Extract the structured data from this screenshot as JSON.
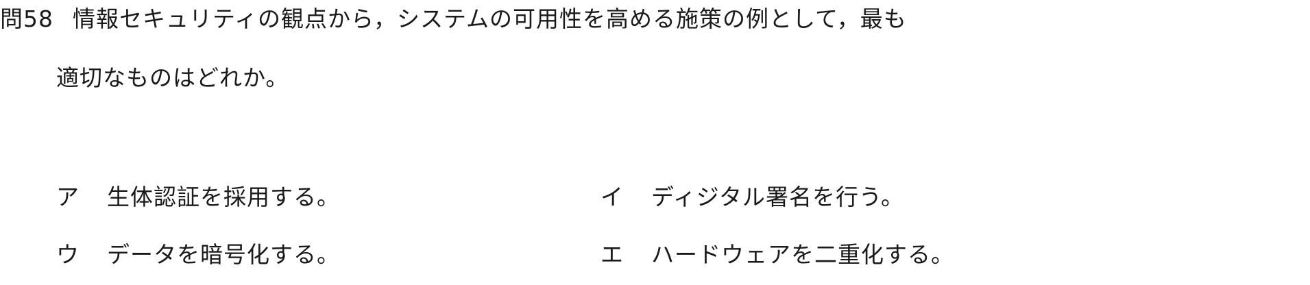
{
  "question": {
    "number": "問58",
    "text_line1": "情報セキュリティの観点から，システムの可用性を高める施策の例として，最も",
    "text_line2": "適切なものはどれか。"
  },
  "choices": [
    {
      "marker": "ア",
      "text": "生体認証を採用する。"
    },
    {
      "marker": "イ",
      "text": "ディジタル署名を行う。"
    },
    {
      "marker": "ウ",
      "text": "データを暗号化する。"
    },
    {
      "marker": "エ",
      "text": "ハードウェアを二重化する。"
    }
  ]
}
